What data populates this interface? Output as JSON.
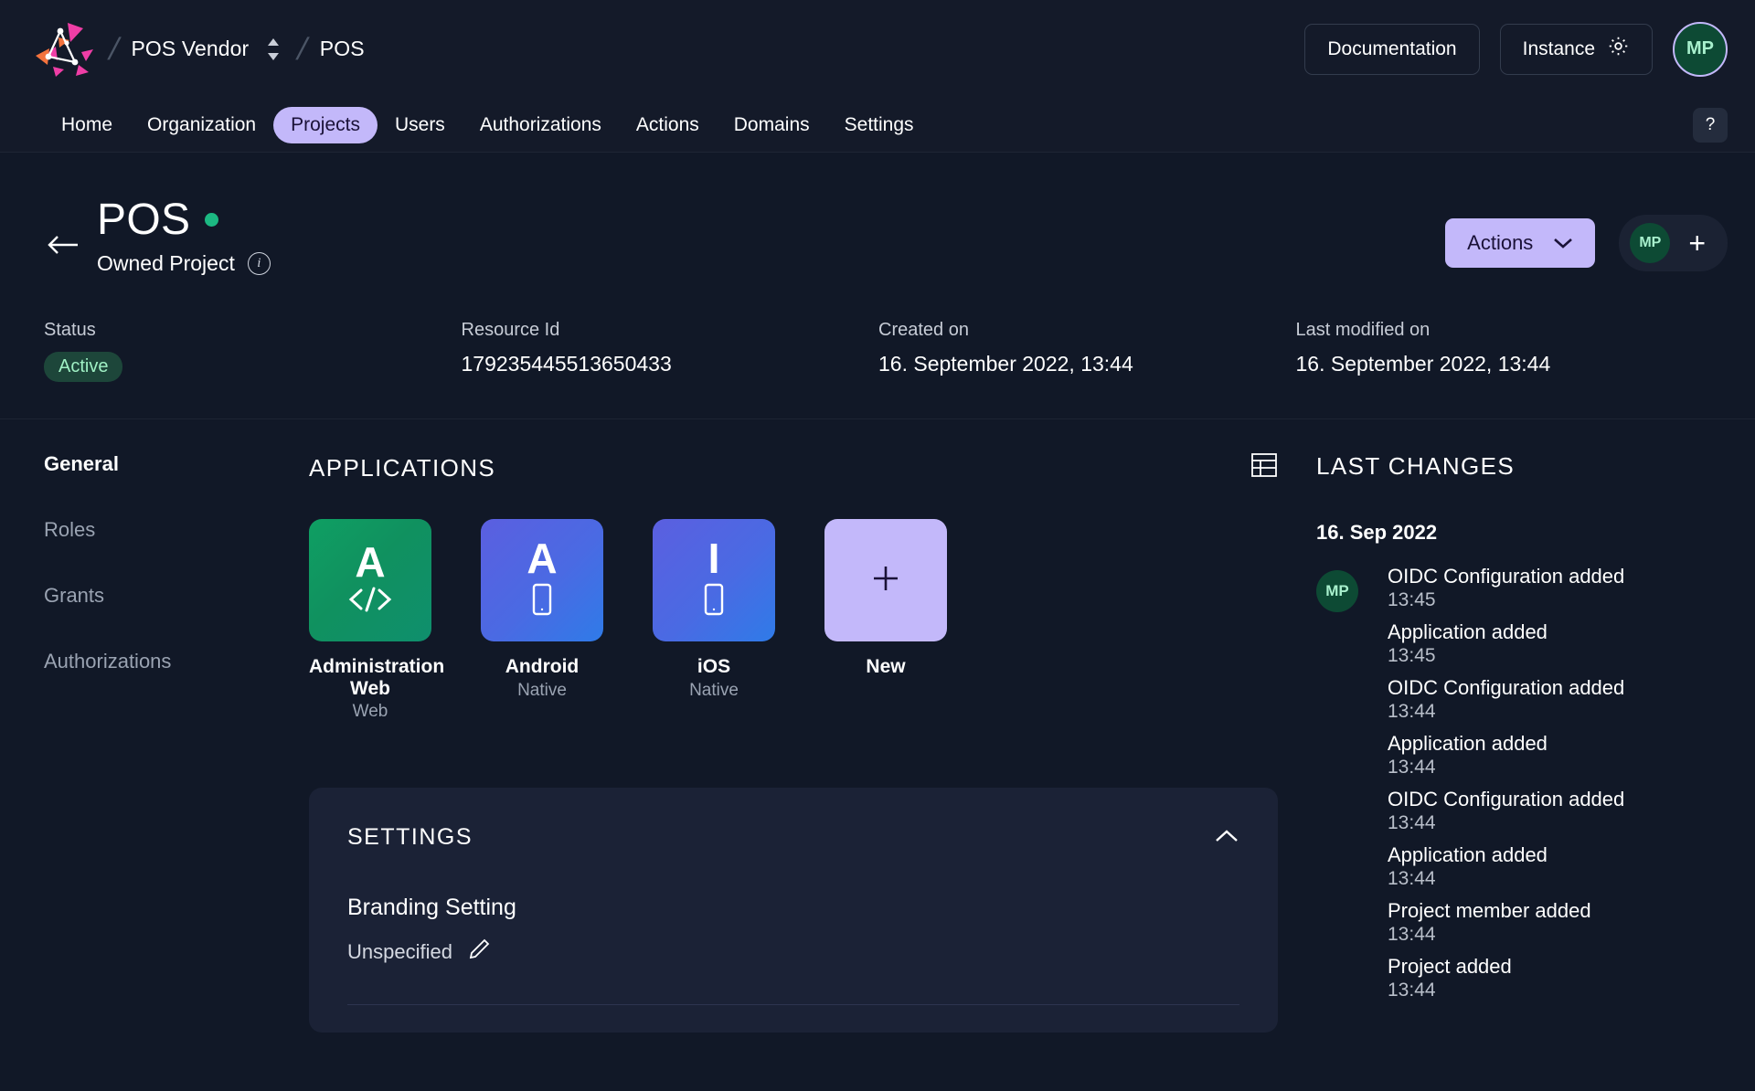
{
  "topbar": {
    "logo_icon": "zitadel-logo-icon",
    "breadcrumb": {
      "org": "POS Vendor",
      "project": "POS",
      "separator": "/",
      "switch_icon": "chevron-up-down-icon"
    },
    "documentation_label": "Documentation",
    "instance_label": "Instance",
    "instance_icon": "gear-icon",
    "avatar_initials": "MP"
  },
  "nav": {
    "items": [
      {
        "label": "Home",
        "active": false
      },
      {
        "label": "Organization",
        "active": false
      },
      {
        "label": "Projects",
        "active": true
      },
      {
        "label": "Users",
        "active": false
      },
      {
        "label": "Authorizations",
        "active": false
      },
      {
        "label": "Actions",
        "active": false
      },
      {
        "label": "Domains",
        "active": false
      },
      {
        "label": "Settings",
        "active": false
      }
    ],
    "help_label": "?"
  },
  "project": {
    "back_icon": "arrow-left-icon",
    "title": "POS",
    "state_dot_color": "#1cb882",
    "subtitle": "Owned Project",
    "info_icon": "info-icon",
    "actions_label": "Actions",
    "actions_chevron_icon": "chevron-down-icon",
    "member_avatar_initials": "MP",
    "add_member_icon": "plus-icon"
  },
  "meta": [
    {
      "label": "Status",
      "value": "Active",
      "is_badge": true
    },
    {
      "label": "Resource Id",
      "value": "179235445513650433",
      "is_badge": false
    },
    {
      "label": "Created on",
      "value": "16. September 2022, 13:44",
      "is_badge": false
    },
    {
      "label": "Last modified on",
      "value": "16. September 2022, 13:44",
      "is_badge": false
    }
  ],
  "sidebar": {
    "items": [
      {
        "label": "General",
        "active": true
      },
      {
        "label": "Roles",
        "active": false
      },
      {
        "label": "Grants",
        "active": false
      },
      {
        "label": "Authorizations",
        "active": false
      }
    ]
  },
  "applications": {
    "heading": "APPLICATIONS",
    "table_view_icon": "table-icon",
    "items": [
      {
        "name": "Administration Web",
        "type": "Web",
        "letter": "A",
        "glyph_icon": "code-brackets-icon",
        "tile": "green"
      },
      {
        "name": "Android",
        "type": "Native",
        "letter": "A",
        "glyph_icon": "mobile-phone-icon",
        "tile": "blue"
      },
      {
        "name": "iOS",
        "type": "Native",
        "letter": "I",
        "glyph_icon": "mobile-phone-icon",
        "tile": "blue"
      }
    ],
    "new": {
      "name": "New",
      "plus_icon": "plus-icon"
    }
  },
  "settings_card": {
    "heading": "SETTINGS",
    "collapse_icon": "chevron-up-icon",
    "branding_label": "Branding Setting",
    "branding_value": "Unspecified",
    "edit_icon": "pencil-icon"
  },
  "last_changes": {
    "heading": "LAST CHANGES",
    "date": "16. Sep 2022",
    "avatar_initials": "MP",
    "items": [
      {
        "text": "OIDC Configuration added",
        "time": "13:45"
      },
      {
        "text": "Application added",
        "time": "13:45"
      },
      {
        "text": "OIDC Configuration added",
        "time": "13:44"
      },
      {
        "text": "Application added",
        "time": "13:44"
      },
      {
        "text": "OIDC Configuration added",
        "time": "13:44"
      },
      {
        "text": "Application added",
        "time": "13:44"
      },
      {
        "text": "Project member added",
        "time": "13:44"
      },
      {
        "text": "Project added",
        "time": "13:44"
      }
    ]
  },
  "colors": {
    "background": "#111827",
    "surface": "#141a29",
    "accent": "#c3b8fa",
    "card": "#1b2236",
    "success": "#1cb882"
  }
}
